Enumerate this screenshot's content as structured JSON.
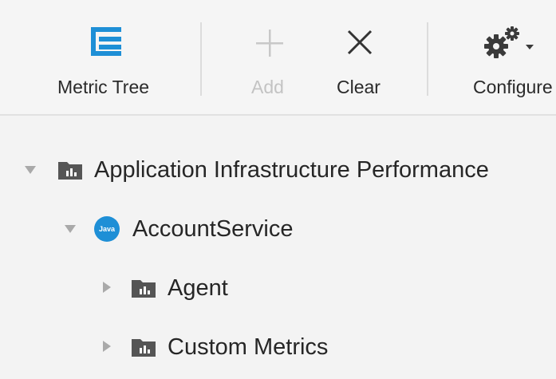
{
  "toolbar": {
    "metric_tree": {
      "label": "Metric Tree",
      "icon": "metric-tree-icon",
      "color": "#1e8fd6"
    },
    "add": {
      "label": "Add",
      "icon": "plus-icon",
      "enabled": false
    },
    "clear": {
      "label": "Clear",
      "icon": "close-icon"
    },
    "configure": {
      "label": "Configure",
      "icon": "gear-icon"
    }
  },
  "tree": {
    "root": {
      "label": "Application Infrastructure Performance",
      "expanded": true,
      "icon": "folder-chart-icon"
    },
    "service": {
      "label": "AccountService",
      "badge": "Java",
      "expanded": true
    },
    "children": [
      {
        "label": "Agent",
        "expanded": false,
        "icon": "folder-chart-icon"
      },
      {
        "label": "Custom Metrics",
        "expanded": false,
        "icon": "folder-chart-icon"
      }
    ]
  }
}
